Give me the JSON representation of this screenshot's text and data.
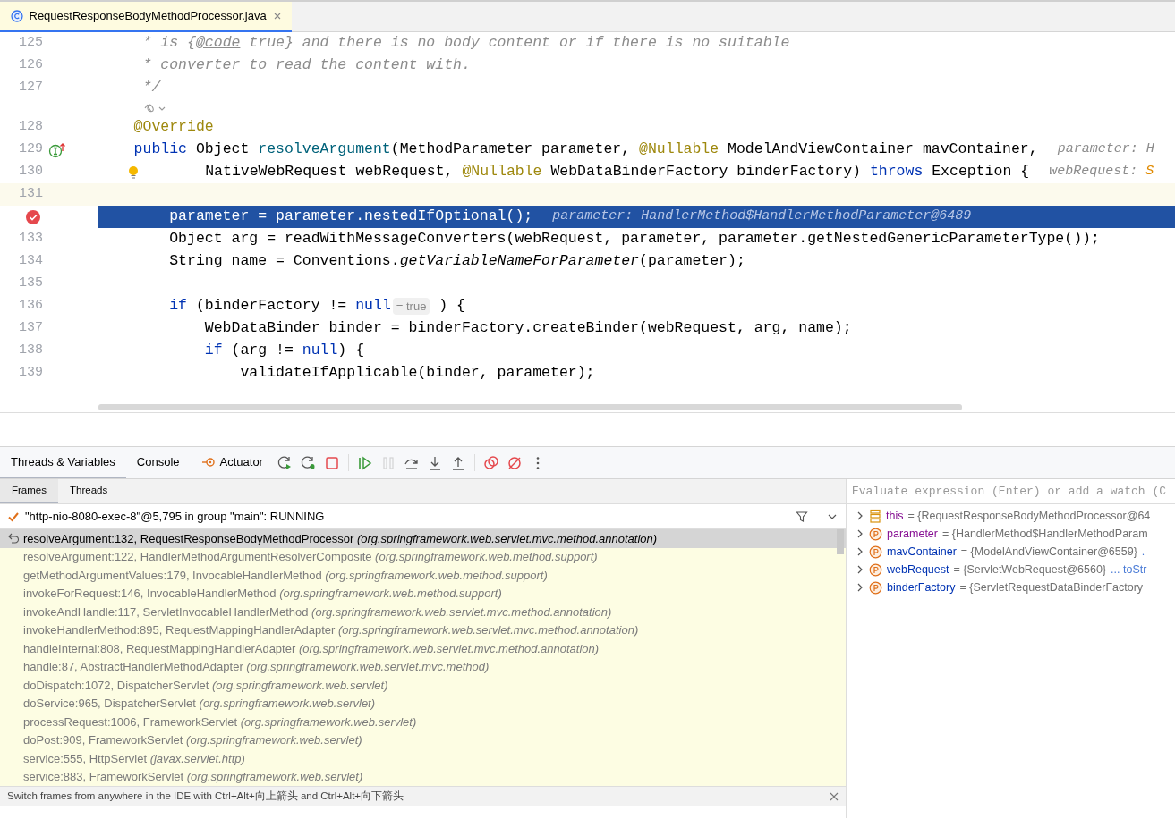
{
  "editor_tab": {
    "title": "RequestResponseBodyMethodProcessor.java",
    "selected": true
  },
  "code_lines": [
    {
      "kind": "code",
      "number": "125",
      "current": false,
      "selected": false,
      "tokens": [
        {
          "text": "     * is {",
          "kind": "comment"
        },
        {
          "text": "@code",
          "kind": "doctag"
        },
        {
          "text": " true} and there is no body content or if there is no suitable",
          "kind": "comment"
        }
      ]
    },
    {
      "kind": "code",
      "number": "126",
      "current": false,
      "selected": false,
      "tokens": [
        {
          "text": "     * converter to read the content with.",
          "kind": "comment"
        }
      ]
    },
    {
      "kind": "code",
      "number": "127",
      "current": false,
      "selected": false,
      "tokens": [
        {
          "text": "     */",
          "kind": "comment"
        }
      ]
    },
    {
      "kind": "inlay"
    },
    {
      "kind": "code",
      "number": "128",
      "current": false,
      "selected": false,
      "tokens": [
        {
          "text": "    @Override",
          "kind": "ann"
        }
      ]
    },
    {
      "kind": "code",
      "number": "129",
      "gutter_icon": {
        "kind": "implements"
      },
      "current": false,
      "selected": false,
      "tokens": [
        {
          "text": "    public",
          "kind": "kw"
        },
        {
          "text": " Object ",
          "kind": "plain"
        },
        {
          "text": "resolveArgument",
          "kind": "method"
        },
        {
          "text": "(MethodParameter parameter, ",
          "kind": "plain"
        },
        {
          "text": "@Nullable",
          "kind": "ann"
        },
        {
          "text": " ModelAndViewContainer mavContainer,",
          "kind": "plain"
        }
      ],
      "hint": "parameter: H"
    },
    {
      "kind": "code",
      "number": "130",
      "gutter_icon": {
        "kind": "bulb"
      },
      "current": false,
      "selected": false,
      "tokens": [
        {
          "text": "        NativeWebRequest webRequest, ",
          "kind": "plain"
        },
        {
          "text": "@Nullable",
          "kind": "ann"
        },
        {
          "text": " WebDataBinderFactory binderFactory) ",
          "kind": "plain"
        },
        {
          "text": "throws",
          "kind": "kw"
        },
        {
          "text": " Exception {",
          "kind": "plain"
        }
      ],
      "hint": "webRequest: ",
      "hint_value": "S"
    },
    {
      "kind": "code",
      "number": "131",
      "current": true,
      "selected": false
    },
    {
      "kind": "code",
      "gutter_icon": {
        "kind": "breakpoint"
      },
      "current": false,
      "selected": true,
      "tokens": [
        {
          "text": "        parameter = parameter.nestedIfOptional();",
          "kind": "plain"
        }
      ],
      "hint": "parameter: HandlerMethod$HandlerMethodParameter@6489"
    },
    {
      "kind": "code",
      "number": "133",
      "current": false,
      "selected": false,
      "tokens": [
        {
          "text": "        Object arg = readWithMessageConverters(webRequest, parameter, parameter.getNestedGenericParameterType());",
          "kind": "plain"
        }
      ]
    },
    {
      "kind": "code",
      "number": "134",
      "current": false,
      "selected": false,
      "tokens": [
        {
          "text": "        String name = Conventions.",
          "kind": "plain"
        },
        {
          "text": "getVariableNameForParameter",
          "kind": "static"
        },
        {
          "text": "(parameter);",
          "kind": "plain"
        }
      ]
    },
    {
      "kind": "code",
      "number": "135",
      "current": false,
      "selected": false
    },
    {
      "kind": "code",
      "number": "136",
      "current": false,
      "selected": false,
      "tokens": [
        {
          "text": "        if",
          "kind": "kw"
        },
        {
          "text": " (binderFactory != ",
          "kind": "plain"
        },
        {
          "text": "null",
          "kind": "kw"
        }
      ],
      "inline_value": "= true",
      "tail": " ) {"
    },
    {
      "kind": "code",
      "number": "137",
      "current": false,
      "selected": false,
      "tokens": [
        {
          "text": "            WebDataBinder binder = binderFactory.createBinder(webRequest, arg, name);",
          "kind": "plain"
        }
      ]
    },
    {
      "kind": "code",
      "number": "138",
      "current": false,
      "selected": false,
      "tokens": [
        {
          "text": "            if",
          "kind": "kw"
        },
        {
          "text": " (arg != ",
          "kind": "plain"
        },
        {
          "text": "null",
          "kind": "kw"
        },
        {
          "text": ") {",
          "kind": "plain"
        }
      ]
    },
    {
      "kind": "code",
      "number": "139",
      "current": false,
      "selected": false,
      "tokens": [
        {
          "text": "                validateIfApplicable(binder, parameter);",
          "kind": "plain"
        }
      ]
    }
  ],
  "tool_tabs": [
    {
      "label": "Threads & Variables",
      "selected": true
    },
    {
      "label": "Console",
      "selected": false
    },
    {
      "label": "Actuator",
      "selected": false,
      "kind": "actuator"
    }
  ],
  "toolbar": [
    {
      "kind": "rerun",
      "disabled": false
    },
    {
      "kind": "rerun-debug",
      "disabled": false
    },
    {
      "kind": "stop",
      "disabled": false
    },
    {
      "kind": "sep"
    },
    {
      "kind": "resume",
      "disabled": false
    },
    {
      "kind": "pause",
      "disabled": true
    },
    {
      "kind": "step-over",
      "disabled": false
    },
    {
      "kind": "step-into",
      "disabled": false
    },
    {
      "kind": "step-out",
      "disabled": false
    },
    {
      "kind": "sep"
    },
    {
      "kind": "breakpoints",
      "disabled": false
    },
    {
      "kind": "mute",
      "disabled": false
    },
    {
      "kind": "more",
      "disabled": false
    }
  ],
  "sub_tabs": [
    {
      "label": "Frames",
      "selected": true
    },
    {
      "label": "Threads",
      "selected": false
    }
  ],
  "thread": {
    "label": "\"http-nio-8080-exec-8\"@5,795 in group \"main\": RUNNING"
  },
  "frames": [
    {
      "text": "resolveArgument:132, RequestResponseBodyMethodProcessor *(org.springframework.web.servlet.mvc.method.annotation)*",
      "selected": true
    },
    {
      "text": "resolveArgument:122, HandlerMethodArgumentResolverComposite *(org.springframework.web.method.support)*",
      "selected": false
    },
    {
      "text": "getMethodArgumentValues:179, InvocableHandlerMethod *(org.springframework.web.method.support)*",
      "selected": false
    },
    {
      "text": "invokeForRequest:146, InvocableHandlerMethod *(org.springframework.web.method.support)*",
      "selected": false
    },
    {
      "text": "invokeAndHandle:117, ServletInvocableHandlerMethod *(org.springframework.web.servlet.mvc.method.annotation)*",
      "selected": false
    },
    {
      "text": "invokeHandlerMethod:895, RequestMappingHandlerAdapter *(org.springframework.web.servlet.mvc.method.annotation)*",
      "selected": false
    },
    {
      "text": "handleInternal:808, RequestMappingHandlerAdapter *(org.springframework.web.servlet.mvc.method.annotation)*",
      "selected": false
    },
    {
      "text": "handle:87, AbstractHandlerMethodAdapter *(org.springframework.web.servlet.mvc.method)*",
      "selected": false
    },
    {
      "text": "doDispatch:1072, DispatcherServlet *(org.springframework.web.servlet)*",
      "selected": false
    },
    {
      "text": "doService:965, DispatcherServlet *(org.springframework.web.servlet)*",
      "selected": false
    },
    {
      "text": "processRequest:1006, FrameworkServlet *(org.springframework.web.servlet)*",
      "selected": false
    },
    {
      "text": "doPost:909, FrameworkServlet *(org.springframework.web.servlet)*",
      "selected": false
    },
    {
      "text": "service:555, HttpServlet *(javax.servlet.http)*",
      "selected": false
    },
    {
      "text": "service:883, FrameworkServlet *(org.springframework.web.servlet)*",
      "selected": false
    }
  ],
  "hint_bar": {
    "text": "Switch frames from anywhere in the IDE with Ctrl+Alt+向上箭头 and Ctrl+Alt+向下箭头"
  },
  "evaluate": {
    "placeholder": "Evaluate expression (Enter) or add a watch (C"
  },
  "variables": [
    {
      "kind": "this",
      "name": "this",
      "color": "#871094",
      "value": "= {RequestResponseBodyMethodProcessor@64"
    },
    {
      "kind": "param",
      "name": "parameter",
      "color": "#871094",
      "value": "= {HandlerMethod$HandlerMethodParam"
    },
    {
      "kind": "param",
      "name": "mavContainer",
      "color": "#0033b3",
      "value": "= {ModelAndViewContainer@6559}",
      "extra": "."
    },
    {
      "kind": "param",
      "name": "webRequest",
      "color": "#0033b3",
      "value": "= {ServletWebRequest@6560}",
      "extra": "... toStr"
    },
    {
      "kind": "param",
      "name": "binderFactory",
      "color": "#0033b3",
      "value": "= {ServletRequestDataBinderFactory"
    }
  ]
}
